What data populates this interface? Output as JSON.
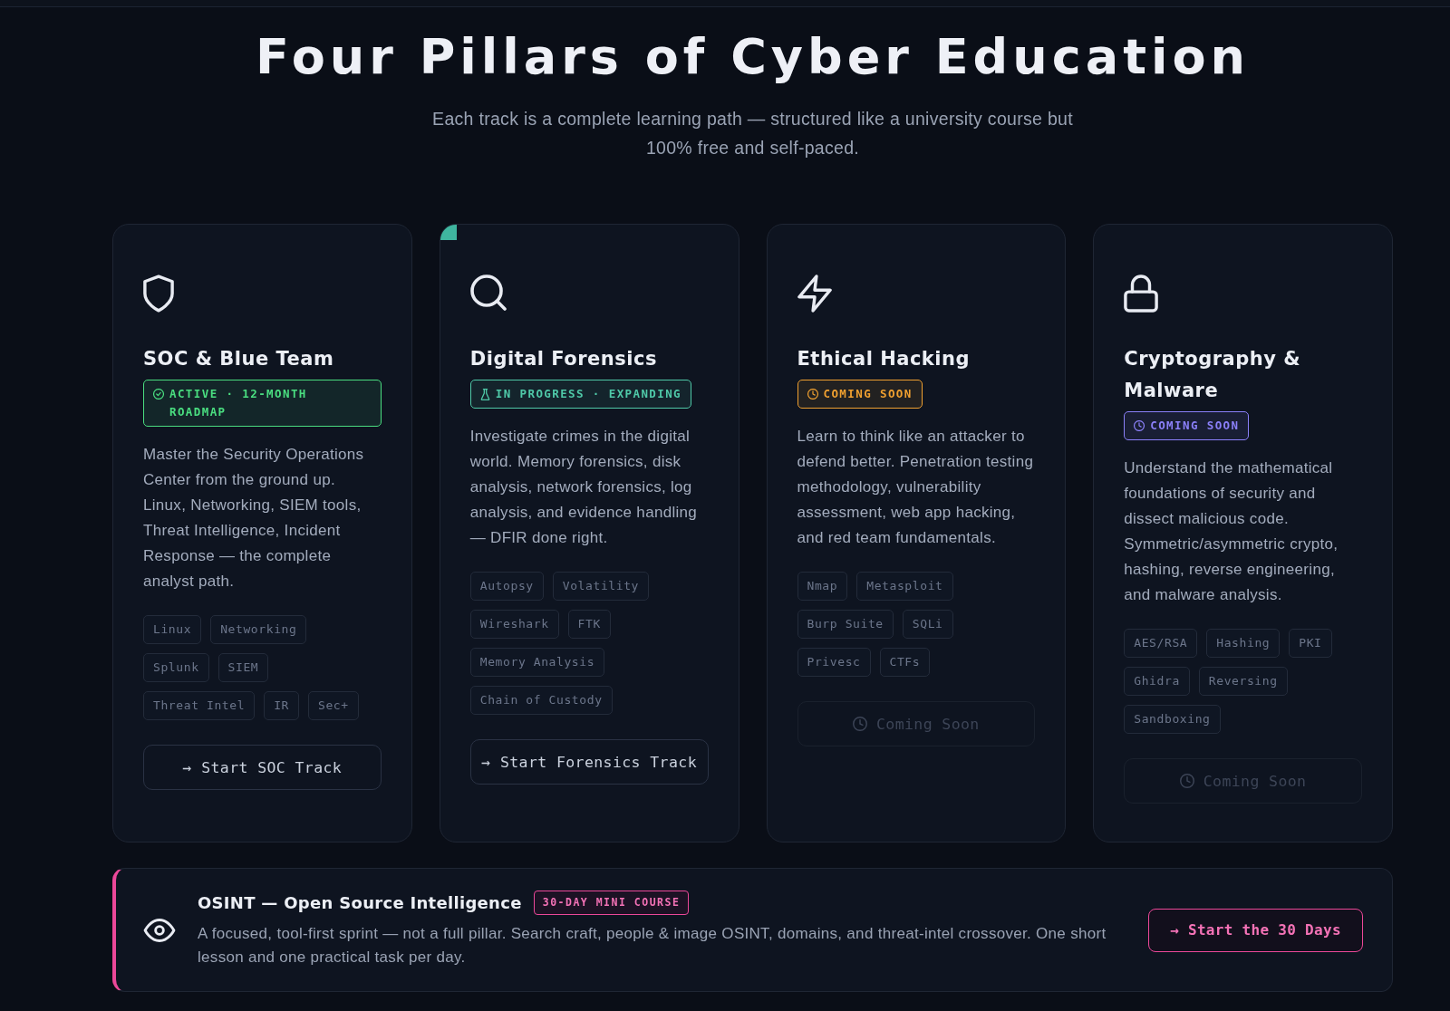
{
  "section": {
    "title": "Four Pillars of Cyber Education",
    "subtitle": "Each track is a complete learning path — structured like a university course but 100% free and self-paced."
  },
  "cards": [
    {
      "kind": "defense",
      "accent": false,
      "title": "SOC & Blue Team",
      "badge": {
        "kind": "active",
        "label": "ACTIVE · 12-MONTH ROADMAP",
        "color": "#4ade80"
      },
      "description": "Master the Security Operations Center from the ground up. Linux, Networking, SIEM tools, Threat Intelligence, Incident Response — the complete analyst path.",
      "tags": [
        "Linux",
        "Networking",
        "Splunk",
        "SIEM",
        "Threat Intel",
        "IR",
        "Sec+"
      ],
      "button": {
        "label": "→ Start SOC Track",
        "disabled": false
      }
    },
    {
      "kind": "forensics",
      "accent": true,
      "title": "Digital Forensics",
      "badge": {
        "kind": "progress",
        "label": "IN PROGRESS · EXPANDING",
        "color": "#4fc9a8"
      },
      "description": "Investigate crimes in the digital world. Memory forensics, disk analysis, network forensics, log analysis, and evidence handling — DFIR done right.",
      "tags": [
        "Autopsy",
        "Volatility",
        "Wireshark",
        "FTK",
        "Memory Analysis",
        "Chain of Custody"
      ],
      "button": {
        "label": "→ Start Forensics Track",
        "disabled": false
      }
    },
    {
      "kind": "offense",
      "accent": false,
      "title": "Ethical Hacking",
      "badge": {
        "kind": "soon",
        "label": "COMING SOON",
        "color": "#f0a030"
      },
      "description": "Learn to think like an attacker to defend better. Penetration testing methodology, vulnerability assessment, web app hacking, and red team fundamentals.",
      "tags": [
        "Nmap",
        "Metasploit",
        "Burp Suite",
        "SQLi",
        "Privesc",
        "CTFs"
      ],
      "button": {
        "label": "Coming Soon",
        "disabled": true
      }
    },
    {
      "kind": "crypto",
      "accent": false,
      "title": "Cryptography & Malware",
      "badge": {
        "kind": "soon",
        "label": "COMING SOON",
        "color": "#8b80f9"
      },
      "description": "Understand the mathematical foundations of security and dissect malicious code. Symmetric/asymmetric crypto, hashing, reverse engineering, and malware analysis.",
      "tags": [
        "AES/RSA",
        "Hashing",
        "PKI",
        "Ghidra",
        "Reversing",
        "Sandboxing"
      ],
      "button": {
        "label": "Coming Soon",
        "disabled": true
      }
    }
  ],
  "osint": {
    "title": "OSINT — Open Source Intelligence",
    "badge": "30-DAY MINI COURSE",
    "description": "A focused, tool-first sprint — not a full pillar. Search craft, people & image OSINT, domains, and threat-intel crossover. One short lesson and one practical task per day.",
    "button": "→ Start the 30 Days"
  }
}
